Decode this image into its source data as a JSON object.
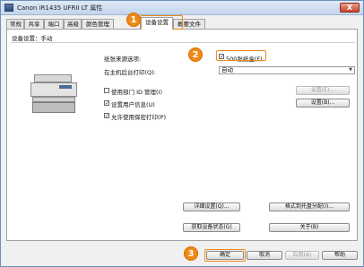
{
  "window": {
    "title": "Canon iR1435 UFRII LT 属性",
    "close_label": "X"
  },
  "tabs": [
    {
      "label": "常规"
    },
    {
      "label": "共享"
    },
    {
      "label": "端口"
    },
    {
      "label": "高级"
    },
    {
      "label": "颜色管理"
    },
    {
      "label": "设备设置"
    },
    {
      "label": "概要文件"
    }
  ],
  "device_settings": {
    "heading": "设备设置：手动",
    "paper_source_label": "纸张来源选项:",
    "paper_feeder_checkbox": {
      "label": "500张纸盒(F)",
      "checked": true
    },
    "host_spool_label": "在主机后台打印(Q):",
    "host_spool_value": "自动",
    "department_id": {
      "label": "使用部门 ID 管理(I)",
      "checked": false,
      "button": "设置(E)..."
    },
    "user_info": {
      "label": "设置用户信息(U)",
      "checked": true,
      "button": "设置(B)..."
    },
    "secure_print": {
      "label": "允许使用保密打印(P)",
      "checked": true
    },
    "detail_button": "详细设置(Q)...",
    "format_button": "格式到托盘分配(I)...",
    "get_device_status_button": "获取设备状态(G)",
    "about_button": "关于(B)"
  },
  "footer": {
    "ok": "确定",
    "cancel": "取消",
    "apply": "应用(A)",
    "help": "帮助"
  },
  "callouts": [
    "1",
    "2",
    "3"
  ],
  "colors": {
    "accent": "#ee8a14"
  }
}
